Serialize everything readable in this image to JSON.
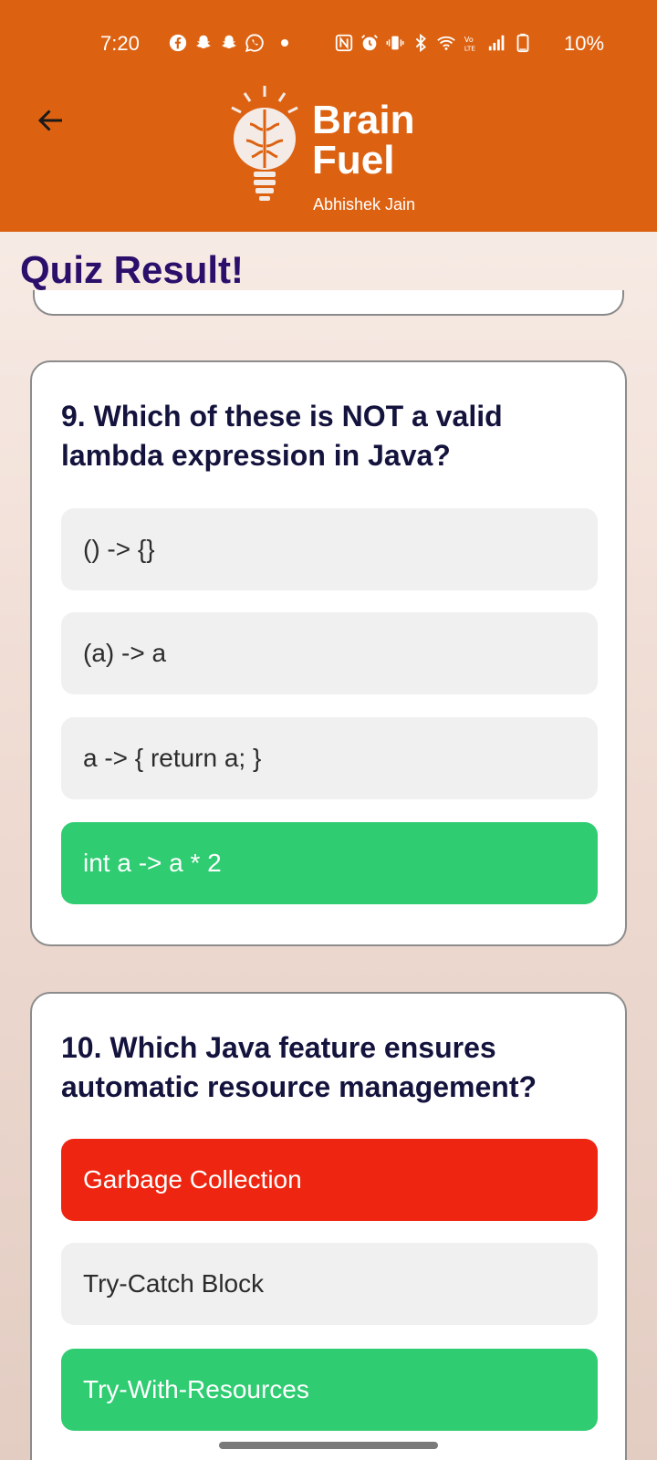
{
  "status_bar": {
    "time": "7:20",
    "battery": "10%",
    "icons_left": [
      "facebook-icon",
      "snapchat-icon",
      "snapchat-icon",
      "whatsapp-icon",
      "dot-icon"
    ],
    "icons_right": [
      "nfc-icon",
      "alarm-icon",
      "vibrate-icon",
      "bluetooth-icon",
      "wifi-icon",
      "volte-icon",
      "signal-icon",
      "battery-icon"
    ]
  },
  "header": {
    "back_icon": "arrow-left-icon",
    "brand_line1": "Brain",
    "brand_line2": "Fuel",
    "author": "Abhishek Jain",
    "background": "#dc6212"
  },
  "page": {
    "title": "Quiz Result!"
  },
  "questions": [
    {
      "text": "9. Which of these is NOT a valid lambda expression in Java?",
      "options": [
        {
          "label": "() -> {}",
          "state": "neutral"
        },
        {
          "label": "(a) -> a",
          "state": "neutral"
        },
        {
          "label": "a -> { return a; }",
          "state": "neutral"
        },
        {
          "label": "int a -> a * 2",
          "state": "correct"
        }
      ]
    },
    {
      "text": "10. Which Java feature ensures automatic resource management?",
      "options": [
        {
          "label": "Garbage Collection",
          "state": "wrong"
        },
        {
          "label": "Try-Catch Block",
          "state": "neutral"
        },
        {
          "label": "Try-With-Resources",
          "state": "correct"
        }
      ]
    }
  ],
  "colors": {
    "correct": "#2fcc72",
    "wrong": "#ee2510",
    "neutral": "#f0f0f0",
    "title": "#2a0f6b",
    "question": "#14133d"
  }
}
